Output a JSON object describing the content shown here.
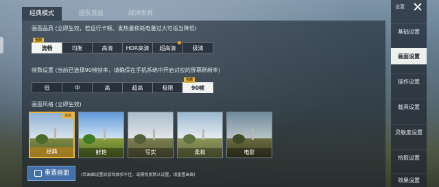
{
  "top_tabs": [
    {
      "label": "经典模式",
      "active": true
    },
    {
      "label": "团队竞技",
      "active": false
    },
    {
      "label": "绿洲世界",
      "active": false
    }
  ],
  "quality": {
    "title": "画面品质 (立即生效，若运行卡顿、发热量和耗电量过大可适当降低)",
    "badge": "当前",
    "options": [
      "流畅",
      "均衡",
      "高清",
      "HDR高清",
      "超高清",
      "极清"
    ],
    "selected": "流畅"
  },
  "fps": {
    "title": "帧数设置 (当前已选择90帧帧率，请确保在手机系统中开启对应的屏幕刷新率)",
    "badge": "当前",
    "options": [
      "低",
      "中",
      "高",
      "超高",
      "极限",
      "90帧"
    ],
    "selected": "90帧"
  },
  "style": {
    "title": "画面风格 (立即生效)",
    "badge": "当前",
    "options": [
      "经典",
      "鲜艳",
      "写实",
      "柔和",
      "电影"
    ],
    "selected": "经典"
  },
  "reset": {
    "label": "重置画面",
    "note": "(若画面设置后游戏体验不佳，或需恢复默认设置，请重置画面)"
  },
  "sidebar": {
    "header": "设置",
    "items": [
      {
        "label": "基础设置",
        "active": false
      },
      {
        "label": "画面设置",
        "active": true
      },
      {
        "label": "操作设置",
        "active": false
      },
      {
        "label": "载具设置",
        "active": false
      },
      {
        "label": "灵敏度设置",
        "active": false
      },
      {
        "label": "拾取设置",
        "active": false
      },
      {
        "label": "效果设置",
        "active": false
      }
    ]
  },
  "colors": {
    "accent_gold": "#e8b640",
    "reset_blue": "#4470a8",
    "selected_bg": "#f3f4f2"
  }
}
